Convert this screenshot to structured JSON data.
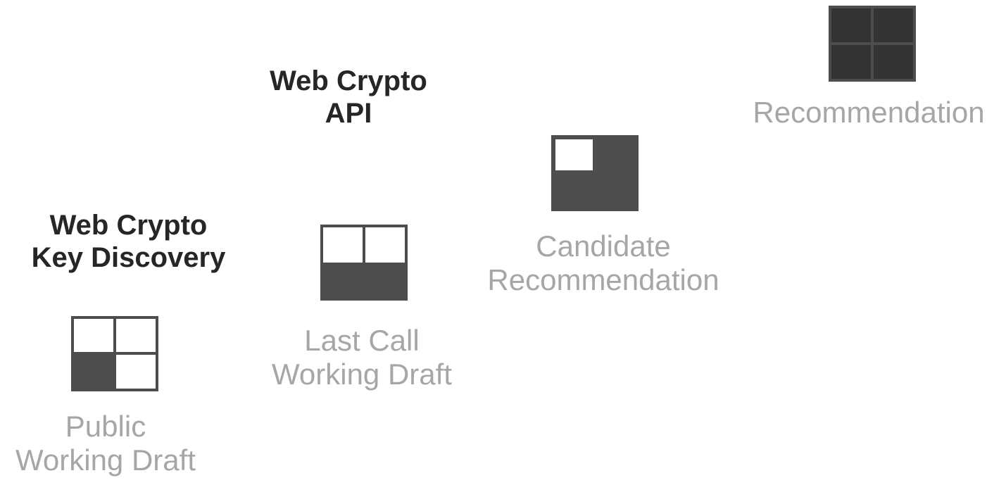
{
  "stages": [
    {
      "id": "pwd",
      "label_lines": [
        "Public",
        "Working Draft"
      ],
      "filled_quadrants": 1
    },
    {
      "id": "lcwd",
      "label_lines": [
        "Last Call",
        "Working Draft"
      ],
      "filled_quadrants": 2
    },
    {
      "id": "cr",
      "label_lines": [
        "Candidate",
        "Recommendation"
      ],
      "filled_quadrants": 3
    },
    {
      "id": "rec",
      "label_lines": [
        "Recommendation"
      ],
      "filled_quadrants": 4
    }
  ],
  "specs": [
    {
      "title_lines": [
        "Web Crypto",
        "Key Discovery"
      ],
      "stage": "pwd"
    },
    {
      "title_lines": [
        "Web Crypto",
        "API"
      ],
      "stage": "cr"
    }
  ],
  "colors": {
    "icon_fill": "#4d4d4d",
    "icon_fill_rec": "#333333",
    "icon_border": "#4d4d4d",
    "label_text": "#a6a6a6",
    "spec_text": "#262626"
  }
}
